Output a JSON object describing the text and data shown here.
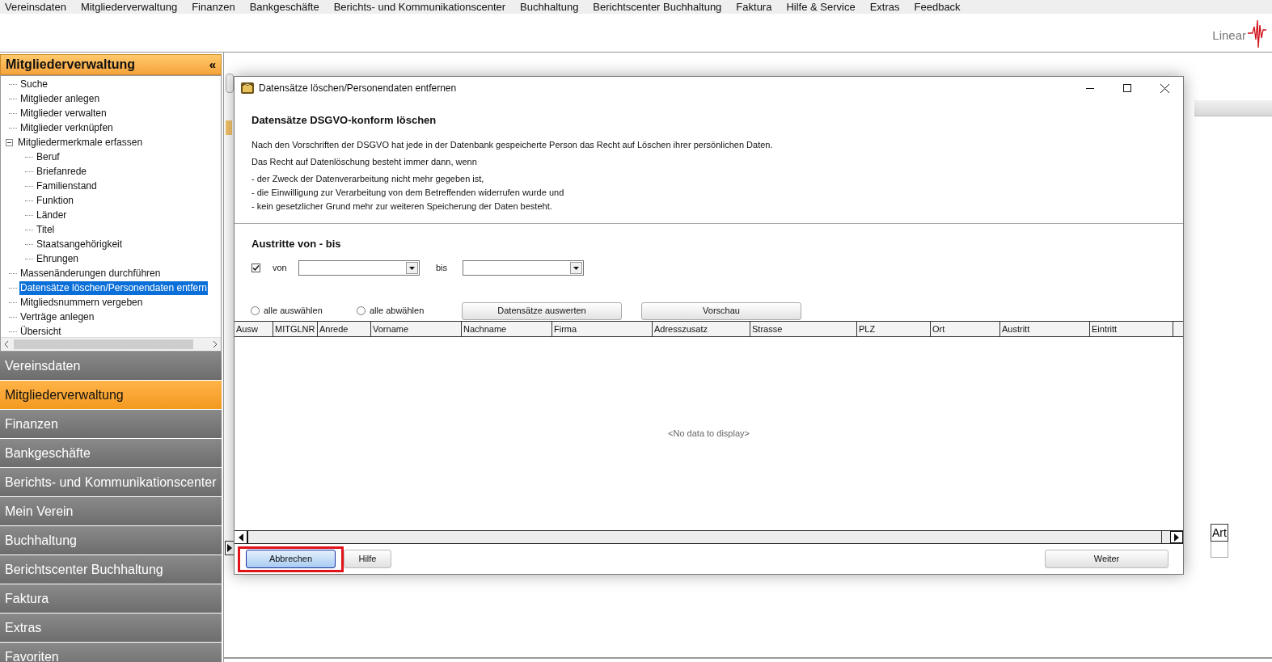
{
  "menu_bar": [
    "Vereinsdaten",
    "Mitgliederverwaltung",
    "Finanzen",
    "Bankgeschäfte",
    "Berichts- und Kommunikationscenter",
    "Buchhaltung",
    "Berichtscenter Buchhaltung",
    "Faktura",
    "Hilfe & Service",
    "Extras",
    "Feedback"
  ],
  "logo": {
    "text": "Linear"
  },
  "sidebar": {
    "title": "Mitgliederverwaltung",
    "collapse": "«",
    "tree": [
      {
        "label": "Suche",
        "selected": false
      },
      {
        "label": "Mitglieder anlegen",
        "selected": false
      },
      {
        "label": "Mitglieder verwalten",
        "selected": false
      },
      {
        "label": "Mitglieder verknüpfen",
        "selected": false
      },
      {
        "label": "Mitgliedermerkmale erfassen",
        "selected": false,
        "expanded": true,
        "children": [
          {
            "label": "Beruf",
            "selected": false
          },
          {
            "label": "Briefanrede",
            "selected": false
          },
          {
            "label": "Familienstand",
            "selected": false
          },
          {
            "label": "Funktion",
            "selected": false
          },
          {
            "label": "Länder",
            "selected": false
          },
          {
            "label": "Titel",
            "selected": false
          },
          {
            "label": "Staatsangehörigkeit",
            "selected": false
          },
          {
            "label": "Ehrungen",
            "selected": false
          }
        ]
      },
      {
        "label": "Massenänderungen durchführen",
        "selected": false
      },
      {
        "label": "Datensätze löschen/Personendaten entfern",
        "selected": true
      },
      {
        "label": "Mitgliedsnummern vergeben",
        "selected": false
      },
      {
        "label": "Verträge anlegen",
        "selected": false
      },
      {
        "label": "Übersicht",
        "selected": false
      }
    ],
    "nav": [
      {
        "label": "Vereinsdaten",
        "selected": false
      },
      {
        "label": "Mitgliederverwaltung",
        "selected": true
      },
      {
        "label": "Finanzen",
        "selected": false
      },
      {
        "label": "Bankgeschäfte",
        "selected": false
      },
      {
        "label": "Berichts- und Kommunikationscenter",
        "selected": false
      },
      {
        "label": "Mein Verein",
        "selected": false
      },
      {
        "label": "Buchhaltung",
        "selected": false
      },
      {
        "label": "Berichtscenter Buchhaltung",
        "selected": false
      },
      {
        "label": "Faktura",
        "selected": false
      },
      {
        "label": "Extras",
        "selected": false
      },
      {
        "label": "Favoriten",
        "selected": false
      }
    ]
  },
  "background": {
    "table_headers": [
      "Art"
    ]
  },
  "dialog": {
    "title": "Datensätze löschen/Personendaten entfernen",
    "heading": "Datensätze DSGVO-konform löschen",
    "paragraphs": [
      "Nach den Vorschriften der DSGVO hat jede in der Datenbank gespeicherte Person das Recht auf Löschen ihrer persönlichen Daten.",
      "Das Recht auf Datenlöschung besteht immer dann, wenn",
      "- der Zweck der Datenverarbeitung nicht mehr gegeben ist,",
      "- die Einwilligung zur Verarbeitung von dem Betreffenden widerrufen wurde und",
      "- kein gesetzlicher Grund mehr zur weiteren Speicherung der Daten besteht."
    ],
    "section_title": "Austritte von - bis",
    "von_checkbox": {
      "label": "von",
      "checked": true
    },
    "bis_label": "bis",
    "radios": [
      {
        "label": "alle auswählen",
        "selected": false
      },
      {
        "label": "alle abwählen",
        "selected": false
      }
    ],
    "action_buttons": [
      "Datensätze auswerten",
      "Vorschau"
    ],
    "table": {
      "columns": [
        "Ausw",
        "MITGLNR",
        "Anrede",
        "Vorname",
        "Nachname",
        "Firma",
        "Adresszusatz",
        "Strasse",
        "PLZ",
        "Ort",
        "Austritt",
        "Eintritt"
      ],
      "empty_text": "<No data to display>"
    },
    "buttons": [
      {
        "label": "Abbrechen",
        "highlighted": true
      },
      {
        "label": "Hilfe",
        "highlighted": false
      }
    ],
    "next_button": "Weiter"
  }
}
